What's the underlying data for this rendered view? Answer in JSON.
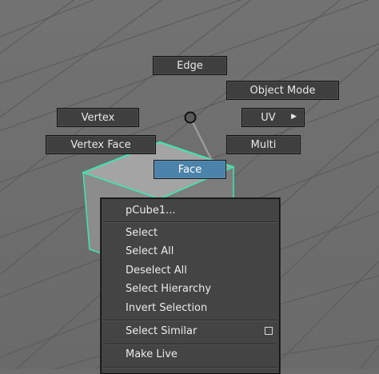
{
  "marking_menu": {
    "edge": "Edge",
    "object_mode": "Object Mode",
    "vertex": "Vertex",
    "uv": "UV",
    "vertex_face": "Vertex Face",
    "multi": "Multi",
    "face": "Face",
    "active_item": "Face"
  },
  "context_menu": {
    "object_name": "pCube1...",
    "items": [
      {
        "label": "Select"
      },
      {
        "label": "Select All"
      },
      {
        "label": "Deselect All"
      },
      {
        "label": "Select Hierarchy"
      },
      {
        "label": "Invert Selection"
      }
    ],
    "select_similar": "Select Similar",
    "make_live": "Make Live"
  },
  "colors": {
    "background": "#6e6e6e",
    "grid_line": "#5c5c5c",
    "cube_face": "#9a9a9a",
    "cube_outline": "#3fe6b0",
    "active_button": "#4b83ab",
    "menu_background": "#444444"
  },
  "icons": {
    "submenu": "submenu-arrow-icon",
    "option_box": "option-box-icon"
  }
}
